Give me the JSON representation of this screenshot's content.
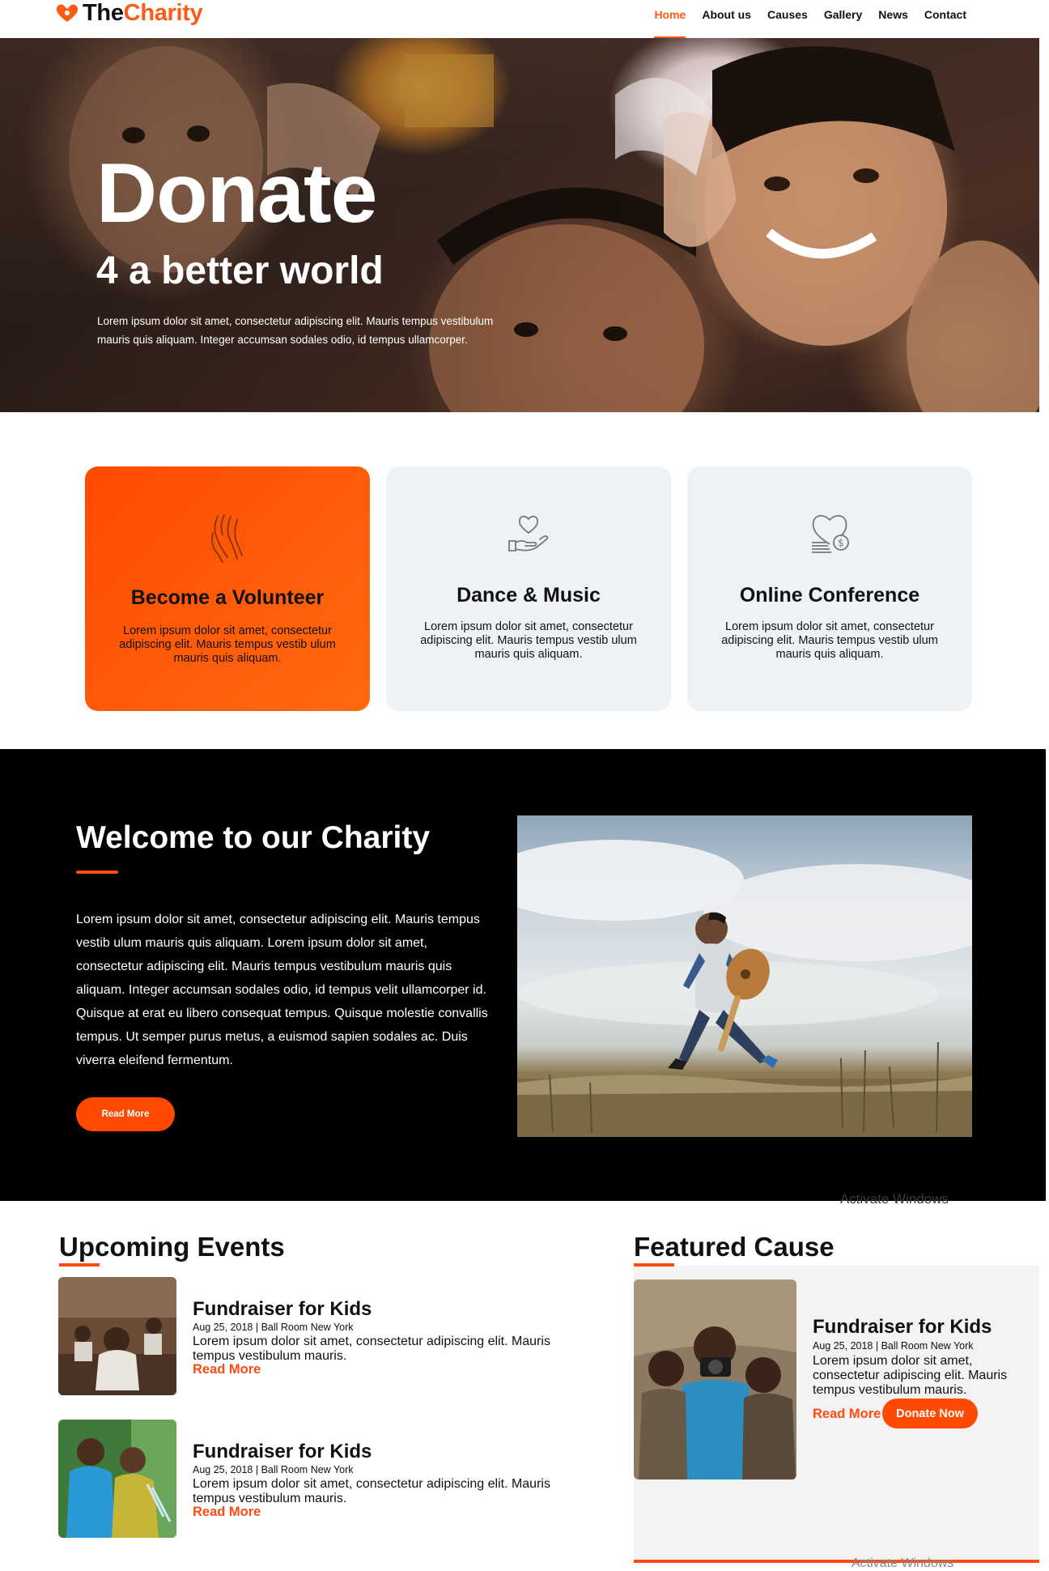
{
  "brand": {
    "name_part1": "The",
    "name_part2": "Charity",
    "accent": "#ff5a14"
  },
  "nav": {
    "items": [
      {
        "label": "Home",
        "active": true
      },
      {
        "label": "About us",
        "active": false
      },
      {
        "label": "Causes",
        "active": false
      },
      {
        "label": "Gallery",
        "active": false
      },
      {
        "label": "News",
        "active": false
      },
      {
        "label": "Contact",
        "active": false
      }
    ]
  },
  "hero": {
    "title": "Donate",
    "subtitle": "4 a better world",
    "text": "Lorem ipsum dolor sit amet, consectetur adipiscing elit. Mauris tempus vestibulum mauris quis aliquam. Integer accumsan sodales odio, id tempus ullamcorper."
  },
  "cards": [
    {
      "icon": "hands-icon",
      "title": "Become a Volunteer",
      "text": "Lorem ipsum dolor sit amet, consectetur adipiscing elit. Mauris tempus vestib ulum mauris quis aliquam."
    },
    {
      "icon": "heart-hand-icon",
      "title": "Dance & Music",
      "text": "Lorem ipsum dolor sit amet, consectetur adipiscing elit. Mauris tempus vestib ulum mauris quis aliquam."
    },
    {
      "icon": "heart-coin-icon",
      "title": "Online Conference",
      "text": "Lorem ipsum dolor sit amet, consectetur adipiscing elit. Mauris tempus vestib ulum mauris quis aliquam."
    }
  ],
  "welcome": {
    "title": "Welcome to our Charity",
    "text": "Lorem ipsum dolor sit amet, consectetur adipiscing elit. Mauris tempus vestib ulum mauris quis aliquam. Lorem ipsum dolor sit amet, consectetur adipiscing elit. Mauris tempus vestibulum mauris quis aliquam. Integer accumsan sodales odio, id tempus velit ullamcorper id. Quisque at erat eu libero consequat tempus. Quisque molestie convallis tempus. Ut semper purus metus, a euismod sapien sodales ac. Duis viverra eleifend fermentum.",
    "button": "Read More",
    "watermark": "Activate Windows"
  },
  "events": {
    "title": "Upcoming Events",
    "items": [
      {
        "title": "Fundraiser for Kids",
        "meta": "Aug 25, 2018 | Ball Room New York",
        "desc": "Lorem ipsum dolor sit amet, consectetur adipiscing elit. Mauris tempus vestibulum mauris.",
        "link": "Read More"
      },
      {
        "title": "Fundraiser for Kids",
        "meta": "Aug 25, 2018 | Ball Room New York",
        "desc": "Lorem ipsum dolor sit amet, consectetur adipiscing elit. Mauris tempus vestibulum mauris.",
        "link": "Read More"
      }
    ]
  },
  "featured": {
    "title": "Featured Cause",
    "name": "Fundraiser for Kids",
    "meta": "Aug 25, 2018 | Ball Room New York",
    "desc": "Lorem ipsum dolor sit amet, consectetur adipiscing elit. Mauris tempus vestibulum mauris.",
    "link": "Read More",
    "button": "Donate Now",
    "watermark": "Activate Windows"
  }
}
